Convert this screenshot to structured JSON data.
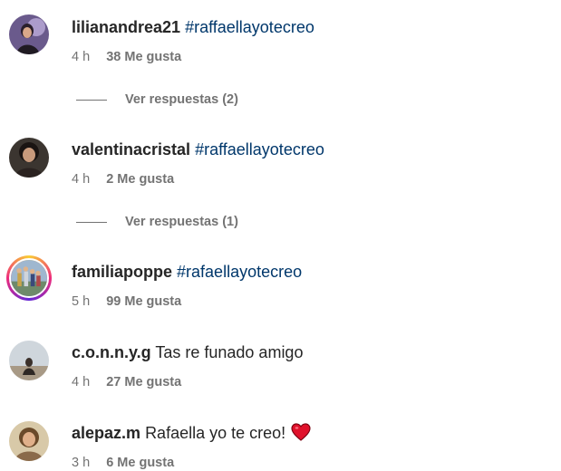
{
  "comments": [
    {
      "username": "lilianandrea21",
      "hashtag": "#raffaellayotecreo",
      "time": "4 h",
      "likes": "38 Me gusta",
      "replies": "Ver respuestas (2)"
    },
    {
      "username": "valentinacristal",
      "hashtag": "#raffaellayotecreo",
      "time": "4 h",
      "likes": "2 Me gusta",
      "replies": "Ver respuestas (1)"
    },
    {
      "username": "familiapoppe",
      "hashtag": "#rafaellayotecreo",
      "time": "5 h",
      "likes": "99 Me gusta"
    },
    {
      "username": "c.o.n.n.y.g",
      "text": "Tas re funado amigo",
      "time": "4 h",
      "likes": "27 Me gusta"
    },
    {
      "username": "alepaz.m",
      "text": "Rafaella yo te creo!",
      "time": "3 h",
      "likes": "6 Me gusta",
      "emoji": "red-heart-icon"
    }
  ],
  "colors": {
    "username": "#262626",
    "hashtag": "#00376b",
    "meta": "#737373",
    "heart": "#e0112b"
  }
}
